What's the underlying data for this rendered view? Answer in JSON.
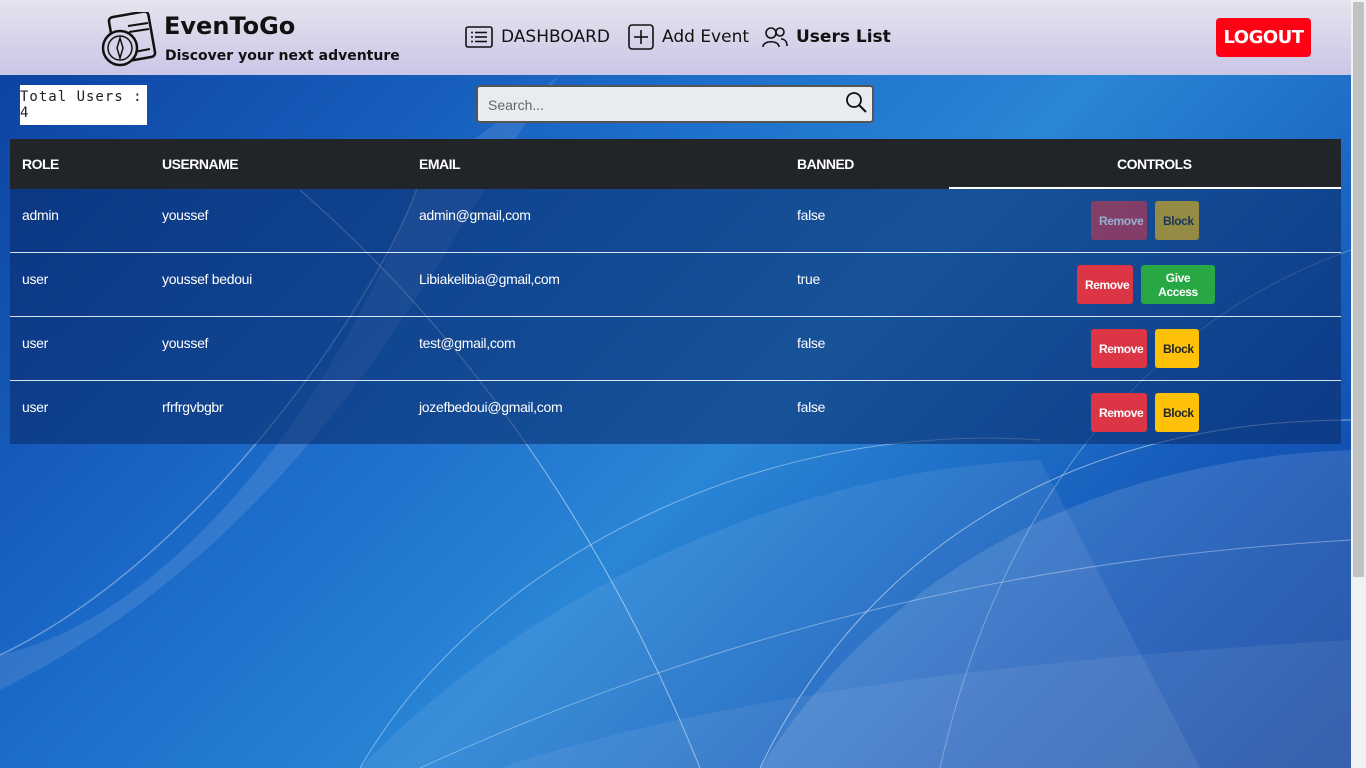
{
  "header": {
    "brand_title": "EvenToGo",
    "brand_subtitle": "Discover your next adventure",
    "nav": [
      {
        "label": "DASHBOARD",
        "icon": "list-icon"
      },
      {
        "label": "Add Event",
        "icon": "plus-square-icon"
      },
      {
        "label": "Users List",
        "icon": "users-icon"
      }
    ],
    "logout_label": "LOGOUT"
  },
  "toolbar": {
    "total_users": "Total Users : 4",
    "search_placeholder": "Search..."
  },
  "table": {
    "headers": [
      "ROLE",
      "USERNAME",
      "EMAIL",
      "BANNED",
      "CONTROLS"
    ],
    "rows": [
      {
        "role": "admin",
        "username": "youssef",
        "email": "admin@gmail,com",
        "banned": "false",
        "controls": [
          "Remove",
          "Block"
        ],
        "disabled": true
      },
      {
        "role": "user",
        "username": "youssef bedoui",
        "email": "Libiakelibia@gmail,com",
        "banned": "true",
        "controls": [
          "Remove",
          "Give Access"
        ],
        "disabled": false
      },
      {
        "role": "user",
        "username": "youssef",
        "email": "test@gmail,com",
        "banned": "false",
        "controls": [
          "Remove",
          "Block"
        ],
        "disabled": false
      },
      {
        "role": "user",
        "username": "rfrfrgvbgbr",
        "email": "jozefbedoui@gmail,com",
        "banned": "false",
        "controls": [
          "Remove",
          "Block"
        ],
        "disabled": false
      }
    ]
  },
  "colors": {
    "remove": "#dc3545",
    "block": "#ffc107",
    "give_access": "#28a745",
    "logout": "#ff0014",
    "table_header": "#212529"
  }
}
